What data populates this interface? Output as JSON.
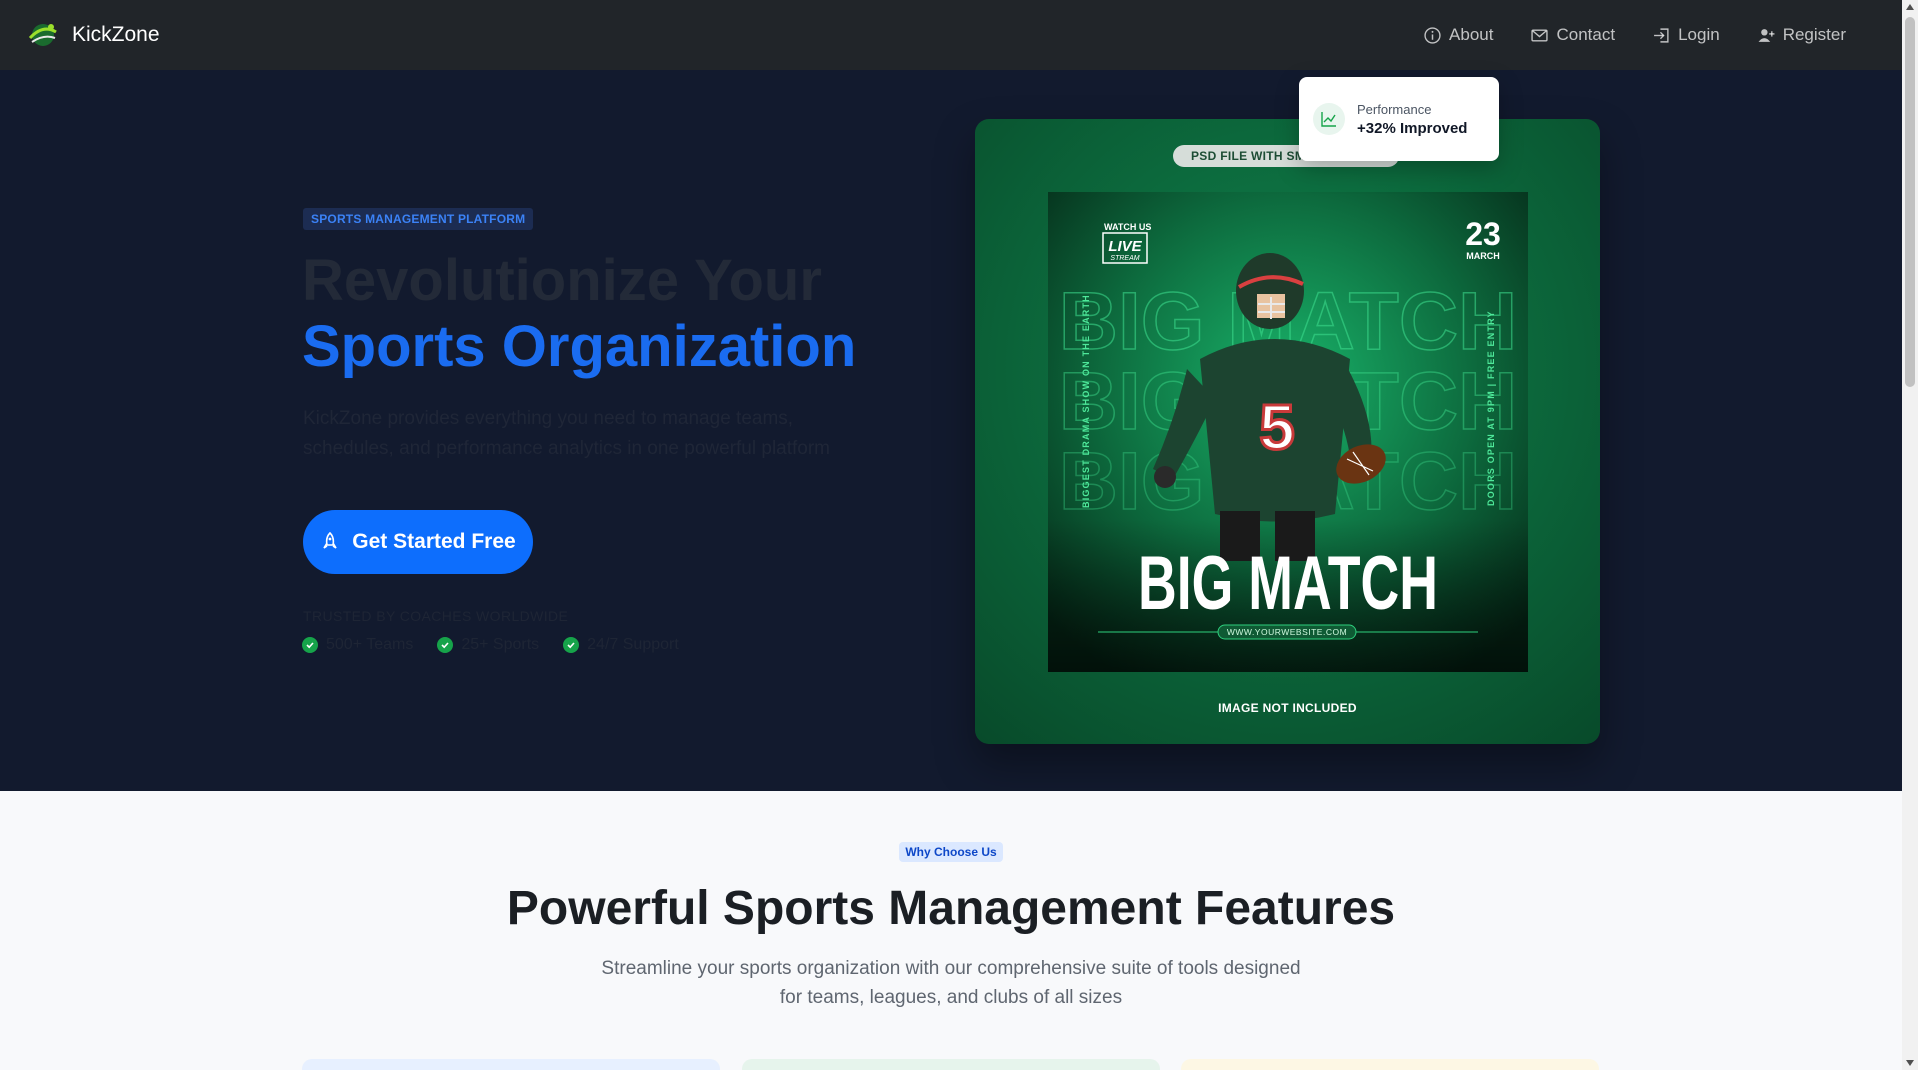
{
  "navbar": {
    "brand": "KickZone",
    "links": [
      {
        "label": "About",
        "icon": "info-icon"
      },
      {
        "label": "Contact",
        "icon": "envelope-icon"
      },
      {
        "label": "Login",
        "icon": "login-icon"
      },
      {
        "label": "Register",
        "icon": "person-plus-icon"
      }
    ]
  },
  "hero": {
    "badge": "SPORTS MANAGEMENT PLATFORM",
    "title_line1": "Revolutionize Your",
    "title_line2": "Sports Organization",
    "description": "KickZone provides everything you need to manage teams, schedules, and performance analytics in one powerful platform",
    "cta_label": "Get Started Free",
    "cta_icon": "rocket-icon",
    "trusted_label": "TRUSTED BY COACHES WORLDWIDE",
    "stats": [
      "500+ Teams",
      "25+ Sports",
      "24/7 Support"
    ],
    "colors": {
      "accent": "#0d6efd",
      "background": "#121a2e",
      "check": "#16a34a"
    }
  },
  "poster": {
    "psd_label": "PSD FILE WITH SMART OBJECT",
    "watch_us": "WATCH US",
    "live": "LIVE",
    "stream": "STREAM",
    "date_day": "23",
    "date_month": "MARCH",
    "left_vertical": "BIGGEST DRAMA SHOW ON THE EARTH",
    "right_vertical": "DOORS OPEN AT 9PM | FREE ENTRY",
    "headline": "BIG MATCH",
    "bg_word": "BIG MATCH",
    "jersey_number": "5",
    "website": "WWW.YOURWEBSITE.COM",
    "image_note": "IMAGE NOT INCLUDED"
  },
  "perf_card": {
    "label": "Performance",
    "value": "+32% Improved",
    "icon": "chart-line-icon"
  },
  "features": {
    "badge": "Why Choose Us",
    "title": "Powerful Sports Management Features",
    "subtitle": "Streamline your sports organization with our comprehensive suite of tools designed for teams, leagues, and clubs of all sizes"
  }
}
